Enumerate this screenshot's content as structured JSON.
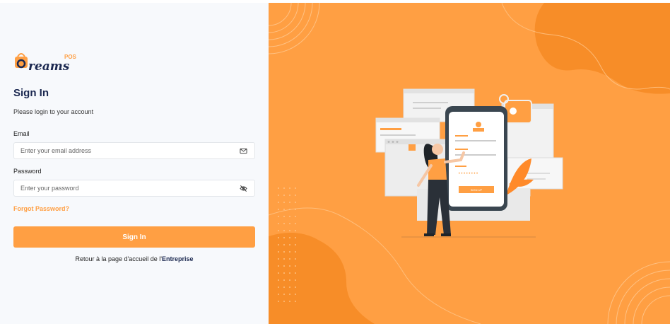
{
  "brand": {
    "logo_text": "Dreams",
    "logo_suffix": "POS",
    "accent_color": "#ff9f43"
  },
  "auth": {
    "title": "Sign In",
    "subtitle": "Please login to your account",
    "email_label": "Email",
    "email_placeholder": "Enter your email address",
    "email_icon": "mail-icon",
    "password_label": "Password",
    "password_placeholder": "Enter your password",
    "password_icon": "eye-off-icon",
    "forgot_label": "Forgot Password?",
    "submit_label": "Sign In",
    "return_prefix": "Retour à la page d'accueil de l'",
    "return_link": "Entreprise"
  },
  "illustration": {
    "name": "login-illustration",
    "phone_button_text": "SIGN UP"
  }
}
